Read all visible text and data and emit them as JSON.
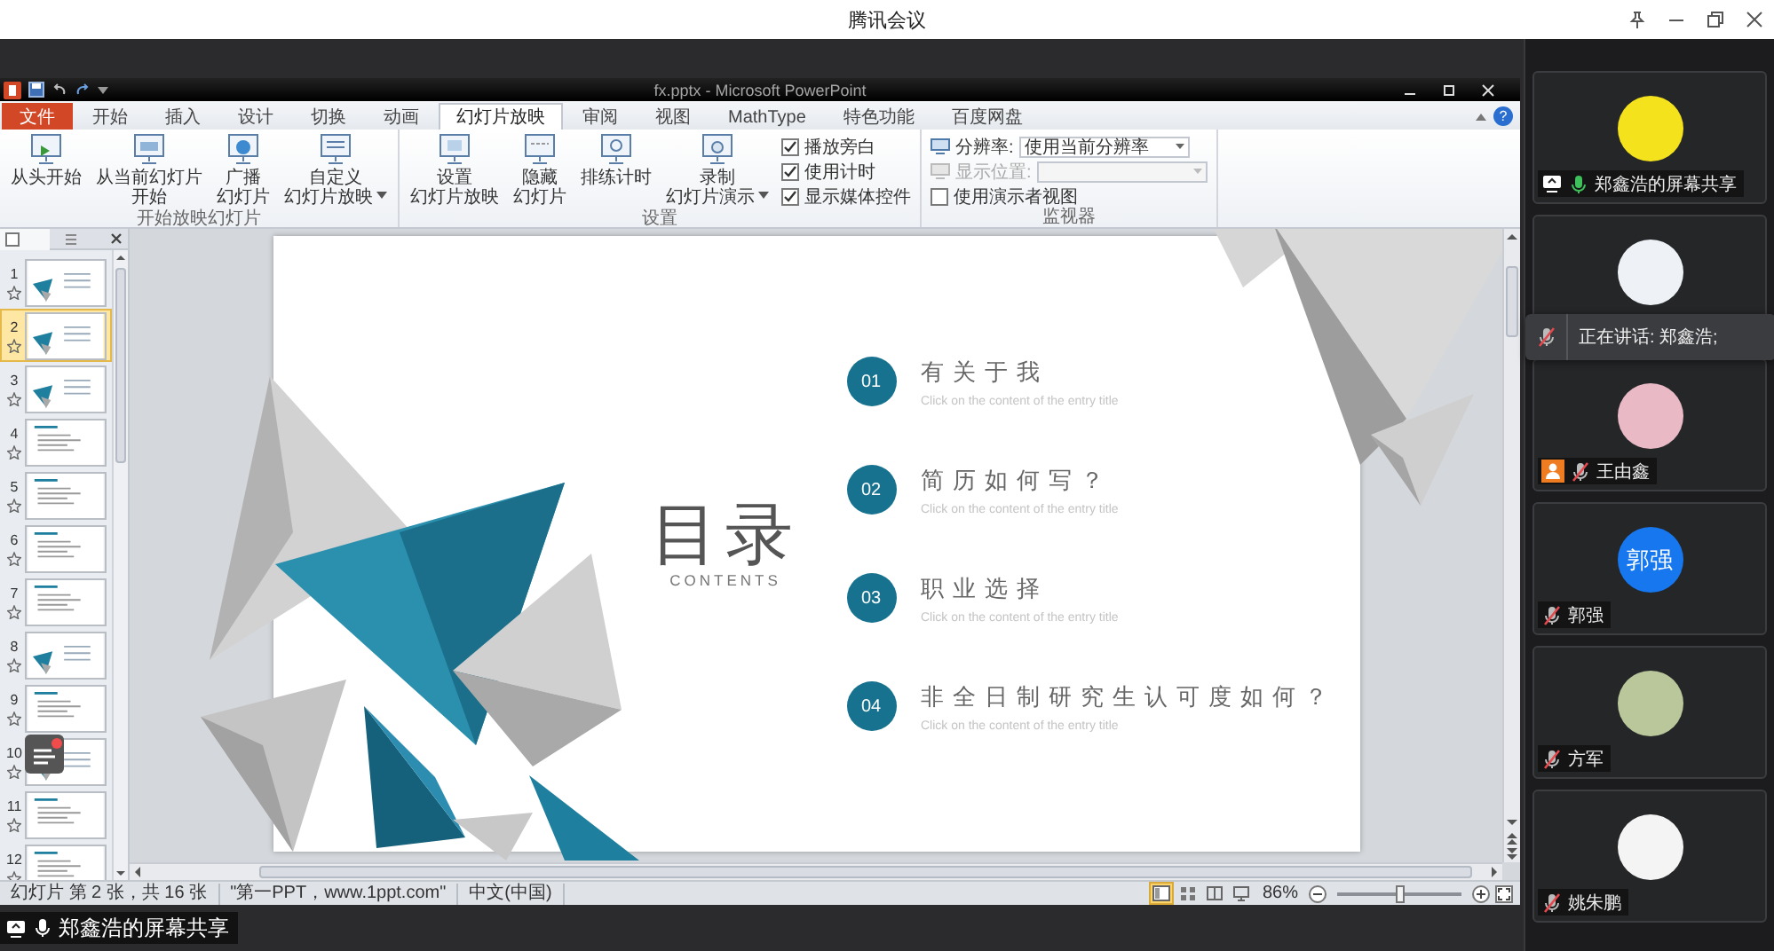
{
  "app": {
    "title": "腾讯会议"
  },
  "ppt": {
    "title": "fx.pptx - Microsoft PowerPoint",
    "help": "?",
    "tabs": [
      {
        "label": "文件",
        "kind": "file",
        "selected": false
      },
      {
        "label": "开始",
        "kind": "tab",
        "selected": false
      },
      {
        "label": "插入",
        "kind": "tab",
        "selected": false
      },
      {
        "label": "设计",
        "kind": "tab",
        "selected": false
      },
      {
        "label": "切换",
        "kind": "tab",
        "selected": false
      },
      {
        "label": "动画",
        "kind": "tab",
        "selected": false
      },
      {
        "label": "幻灯片放映",
        "kind": "tab",
        "selected": true
      },
      {
        "label": "审阅",
        "kind": "tab",
        "selected": false
      },
      {
        "label": "视图",
        "kind": "tab",
        "selected": false
      },
      {
        "label": "MathType",
        "kind": "tab",
        "selected": false
      },
      {
        "label": "特色功能",
        "kind": "tab",
        "selected": false
      },
      {
        "label": "百度网盘",
        "kind": "tab",
        "selected": false
      }
    ],
    "ribbon_groups": [
      {
        "label": "开始放映幻灯片",
        "items": [
          {
            "kind": "large",
            "lines": [
              "从头开始"
            ],
            "dropdown": false
          },
          {
            "kind": "large",
            "lines": [
              "从当前幻灯片",
              "开始"
            ],
            "dropdown": false
          },
          {
            "kind": "large",
            "lines": [
              "广播",
              "幻灯片"
            ],
            "dropdown": false
          },
          {
            "kind": "large",
            "lines": [
              "自定义",
              "幻灯片放映"
            ],
            "dropdown": true
          }
        ]
      },
      {
        "label": "设置",
        "items": [
          {
            "kind": "large",
            "lines": [
              "设置",
              "幻灯片放映"
            ],
            "dropdown": false
          },
          {
            "kind": "large",
            "lines": [
              "隐藏",
              "幻灯片"
            ],
            "dropdown": false
          },
          {
            "kind": "large",
            "lines": [
              "排练计时"
            ],
            "dropdown": false
          },
          {
            "kind": "large",
            "lines": [
              "录制",
              "幻灯片演示"
            ],
            "dropdown": true
          },
          {
            "kind": "checks",
            "options": [
              {
                "label": "播放旁白",
                "checked": true
              },
              {
                "label": "使用计时",
                "checked": true
              },
              {
                "label": "显示媒体控件",
                "checked": true
              }
            ]
          }
        ]
      },
      {
        "label": "监视器",
        "items": [
          {
            "kind": "fields",
            "rows": [
              {
                "kind": "select",
                "label": "分辨率:",
                "value": "使用当前分辨率",
                "disabled": false
              },
              {
                "kind": "select",
                "label": "显示位置:",
                "disabled": true
              },
              {
                "kind": "checkbox",
                "label": "使用演示者视图",
                "checked": false
              }
            ]
          }
        ]
      }
    ],
    "thumbnails": [
      {
        "number": "1",
        "kind": "triangle",
        "selected": false
      },
      {
        "number": "2",
        "kind": "triangle",
        "selected": true
      },
      {
        "number": "3",
        "kind": "triangle",
        "selected": false
      },
      {
        "number": "4",
        "kind": "text",
        "selected": false
      },
      {
        "number": "5",
        "kind": "text",
        "selected": false
      },
      {
        "number": "6",
        "kind": "text",
        "selected": false
      },
      {
        "number": "7",
        "kind": "text",
        "selected": false
      },
      {
        "number": "8",
        "kind": "triangle",
        "selected": false
      },
      {
        "number": "9",
        "kind": "text",
        "selected": false
      },
      {
        "number": "10",
        "kind": "triangle",
        "selected": false
      },
      {
        "number": "11",
        "kind": "text",
        "selected": false
      },
      {
        "number": "12",
        "kind": "text",
        "selected": false
      }
    ],
    "slide": {
      "title": "目录",
      "subtitle": "CONTENTS",
      "items": [
        {
          "number": "01",
          "title": "有关于我",
          "caption": "Click on the content of the entry title"
        },
        {
          "number": "02",
          "title": "简历如何写？",
          "caption": "Click on the content of the entry title"
        },
        {
          "number": "03",
          "title": "职业选择",
          "caption": "Click on the content of the entry title"
        },
        {
          "number": "04",
          "title": "非全日制研究生认可度如何？",
          "caption": "Click on the content of the entry title"
        }
      ]
    },
    "status": {
      "slide_info": "幻灯片 第 2 张，共 16 张",
      "theme": "\"第一PPT，www.1ppt.com\"",
      "language": "中文(中国)",
      "views": [
        {
          "selected": true
        },
        {
          "selected": false
        },
        {
          "selected": false
        },
        {
          "selected": false
        }
      ],
      "zoom": "86%",
      "zoom_slider": {
        "level": 0.5
      }
    }
  },
  "participants": [
    {
      "name": "郑鑫浩的屏幕共享",
      "kind": "image",
      "color": "#f3e21c",
      "sharing": true,
      "muted": false,
      "host": false
    },
    {
      "kind": "image",
      "color": "#eef2f6"
    },
    {
      "name": "王由鑫",
      "kind": "image",
      "color": "#e9b9c6",
      "sharing": false,
      "muted": true,
      "host": true
    },
    {
      "name": "郭强",
      "kind": "text",
      "avatar_text": "郭强",
      "color": "#1677ee",
      "sharing": false,
      "muted": true,
      "host": false
    },
    {
      "name": "方军",
      "kind": "image",
      "color": "#b9c79a",
      "sharing": false,
      "muted": true,
      "host": false
    },
    {
      "name": "姚朱鹏",
      "kind": "image",
      "color": "#f4f4f4",
      "sharing": false,
      "muted": true,
      "host": false
    }
  ],
  "speaking_toast": {
    "text": "正在讲话: 郑鑫浩;"
  },
  "share_label": {
    "text": "郑鑫浩的屏幕共享"
  }
}
